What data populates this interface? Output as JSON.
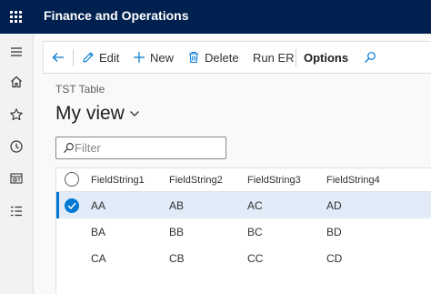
{
  "app": {
    "title": "Finance and Operations"
  },
  "actions": {
    "edit": "Edit",
    "new": "New",
    "delete": "Delete",
    "run_er": "Run ER",
    "options": "Options"
  },
  "breadcrumb": "TST Table",
  "view": {
    "name": "My view"
  },
  "filter": {
    "placeholder": "Filter",
    "value": ""
  },
  "grid": {
    "columns": [
      "FieldString1",
      "FieldString2",
      "FieldString3",
      "FieldString4"
    ],
    "rows": [
      {
        "selected": true,
        "cells": [
          "AA",
          "AB",
          "AC",
          "AD"
        ]
      },
      {
        "selected": false,
        "cells": [
          "BA",
          "BB",
          "BC",
          "BD"
        ]
      },
      {
        "selected": false,
        "cells": [
          "CA",
          "CB",
          "CC",
          "CD"
        ]
      }
    ]
  },
  "colors": {
    "topbar": "#002050",
    "accent": "#0078d4",
    "selected_row": "#e1ecf8"
  },
  "icons": [
    "app-launcher-icon",
    "hamburger-menu-icon",
    "home-icon",
    "favorites-star-icon",
    "recent-clock-icon",
    "workspaces-icon",
    "modules-list-icon",
    "back-arrow-icon",
    "edit-pencil-icon",
    "plus-icon",
    "trash-icon",
    "search-icon",
    "chevron-down-icon",
    "check-icon"
  ]
}
